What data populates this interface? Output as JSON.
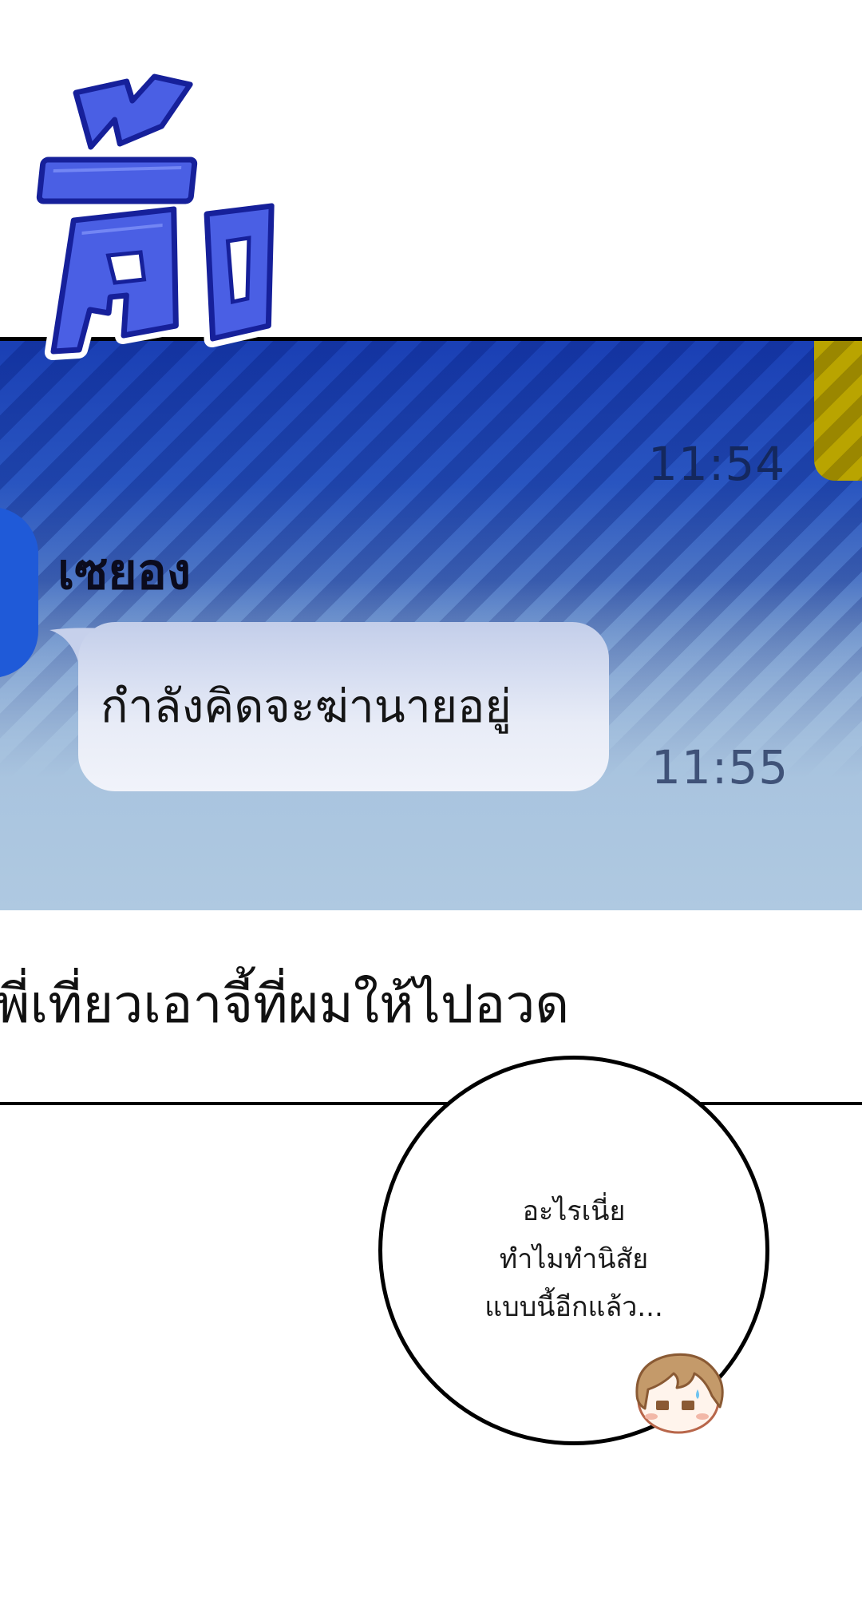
{
  "sfx": {
    "text": "ตึ้ง"
  },
  "chat": {
    "time_top": "11:54",
    "sender_name": "เซยอง",
    "message": "กำลังคิดจะฆ่านายอยู่",
    "time_bottom": "11:55"
  },
  "narration": "พี่เที่ยวเอาจี้ที่ผมให้ไปอวด",
  "thought": {
    "line1": "อะไรเนี่ย",
    "line2": "ทำไมทำนิสัย",
    "line3": "แบบนี้อีกแล้ว..."
  },
  "colors": {
    "panel_top": "#1a3fb4",
    "panel_bottom": "#b2cbe1",
    "sfx_blue": "#3f55e0",
    "bubble": "#eef1f9"
  }
}
